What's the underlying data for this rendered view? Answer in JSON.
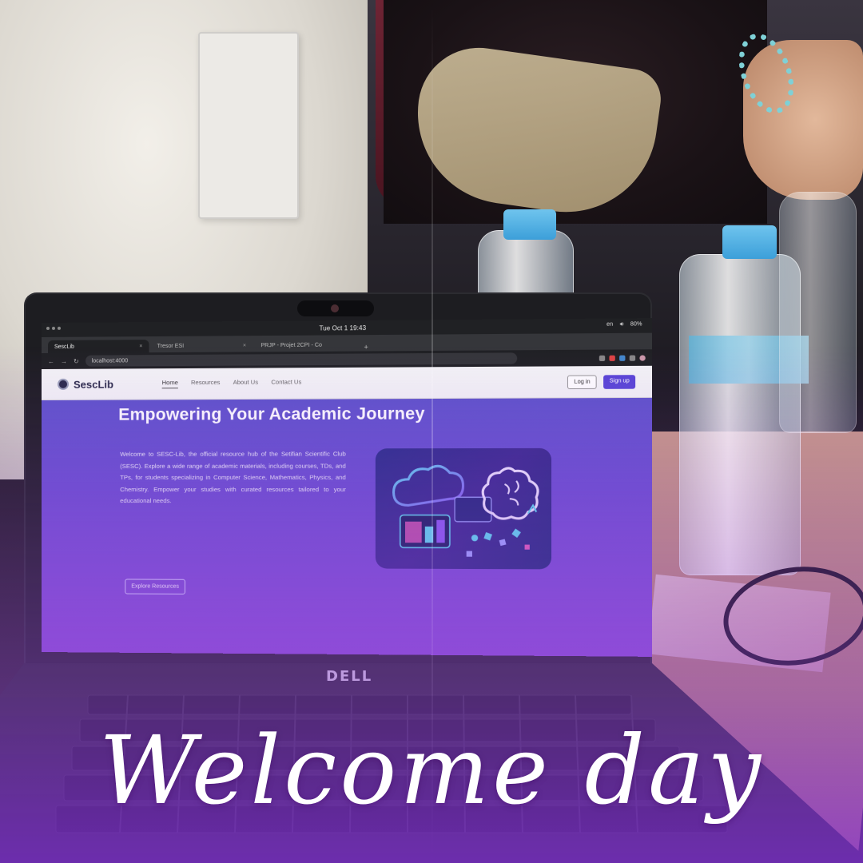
{
  "photo": {
    "caption": "Welcome day",
    "laptop_brand": "DELL"
  },
  "system_bar": {
    "datetime": "Tue Oct 1  19:43",
    "lang": "en",
    "battery": "80%"
  },
  "browser": {
    "tabs": [
      {
        "label": "SescLib",
        "active": true
      },
      {
        "label": "Tresor ESI",
        "active": false
      },
      {
        "label": "PRJP - Projet 2CPI - Co",
        "active": false
      }
    ],
    "new_tab_symbol": "+",
    "url": "localhost:4000"
  },
  "site": {
    "logo_text": "SescLib",
    "nav": [
      "Home",
      "Resources",
      "About Us",
      "Contact Us"
    ],
    "login_label": "Log in",
    "signup_label": "Sign up",
    "hero_title": "Empowering Your Academic Journey",
    "hero_text": "Welcome to SESC-Lib, the official resource hub of the Setifian Scientific Club (SESC). Explore a wide range of academic materials, including courses, TDs, and TPs, for students specializing in Computer Science, Mathematics, Physics, and Chemistry. Empower your studies with curated resources tailored to your educational needs.",
    "cta_label": "Explore Resources"
  },
  "colors": {
    "accent": "#5a46d6",
    "hero_gradient_top": "#5c56c9",
    "hero_gradient_bottom": "#8a4fd6",
    "overlay": "#8c32e6"
  }
}
